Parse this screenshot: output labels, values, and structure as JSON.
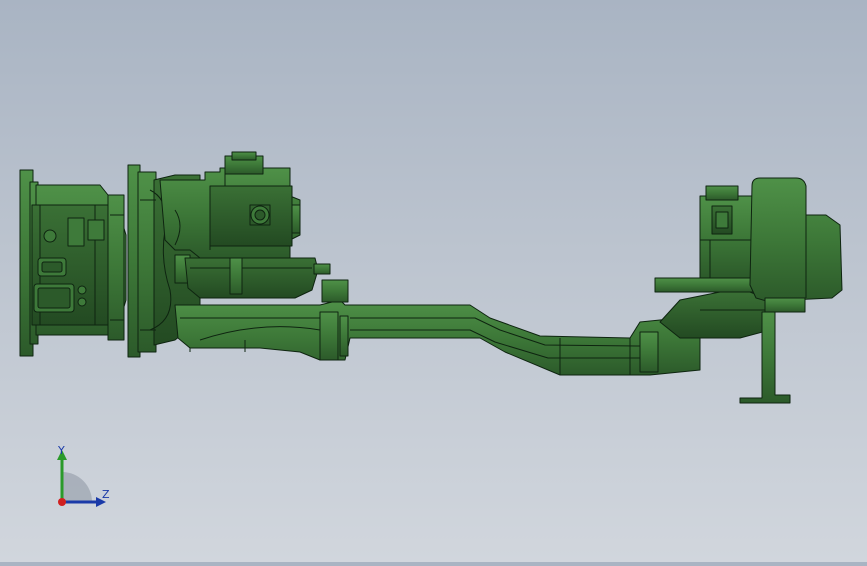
{
  "view": {
    "background_top": "#a9b4c3",
    "background_bottom": "#d1d6dd",
    "model_color": "#3e7a3a",
    "model_edge_color": "#0e2410"
  },
  "triad": {
    "y_label": "Y",
    "z_label": "Z",
    "y_color": "#2a9a2a",
    "z_color": "#1a3aa8",
    "origin_color": "#d02020"
  }
}
